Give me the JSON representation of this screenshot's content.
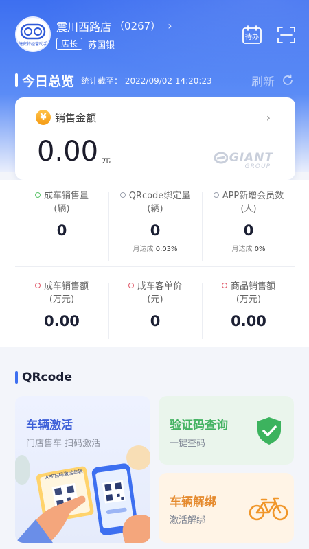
{
  "store": {
    "name": "震川西路店",
    "code": "（0267）",
    "role": "店长",
    "manager": "苏国银",
    "logo_text": "捷安特经营助手"
  },
  "header": {
    "todo_label": "待办"
  },
  "overview": {
    "title": "今日总览",
    "stat_label": "统计截至：",
    "stat_time": "2022/09/02 14:20:23",
    "refresh_label": "刷新"
  },
  "sales": {
    "label": "销售金额",
    "value": "0.00",
    "unit": "元",
    "yen_symbol": "¥",
    "brand": "GIANT",
    "brand_sub": "GROUP"
  },
  "metrics_row1": [
    {
      "label_line1": "成车销售量",
      "label_line2": "(辆)",
      "value": "0",
      "sub_prefix": "",
      "sub_value": "",
      "dot": "green"
    },
    {
      "label_line1": "QRcode绑定量",
      "label_line2": "(辆)",
      "value": "0",
      "sub_prefix": "月达成",
      "sub_value": "0.03%",
      "dot": "gray"
    },
    {
      "label_line1": "APP新增会员数",
      "label_line2": "(人)",
      "value": "0",
      "sub_prefix": "月达成",
      "sub_value": "0%",
      "dot": "gray"
    }
  ],
  "metrics_row2": [
    {
      "label_line1": "成车销售额",
      "label_line2": "(万元)",
      "value": "0.00",
      "dot": "red"
    },
    {
      "label_line1": "成车客单价",
      "label_line2": "(元)",
      "value": "0",
      "dot": "red"
    },
    {
      "label_line1": "商品销售额",
      "label_line2": "(万元)",
      "value": "0.00",
      "dot": "red"
    }
  ],
  "qrcode": {
    "section_title": "QRcode",
    "activate": {
      "title": "车辆激活",
      "subtitle": "门店售车 扫码激活",
      "card_text": "APP扫码激活车辆"
    },
    "verify": {
      "title": "验证码查询",
      "subtitle": "一键查码"
    },
    "unbind": {
      "title": "车辆解绑",
      "subtitle": "激活解绑"
    }
  },
  "colors": {
    "primary": "#3d6ff0",
    "green": "#45b363",
    "orange": "#e58a2e"
  }
}
